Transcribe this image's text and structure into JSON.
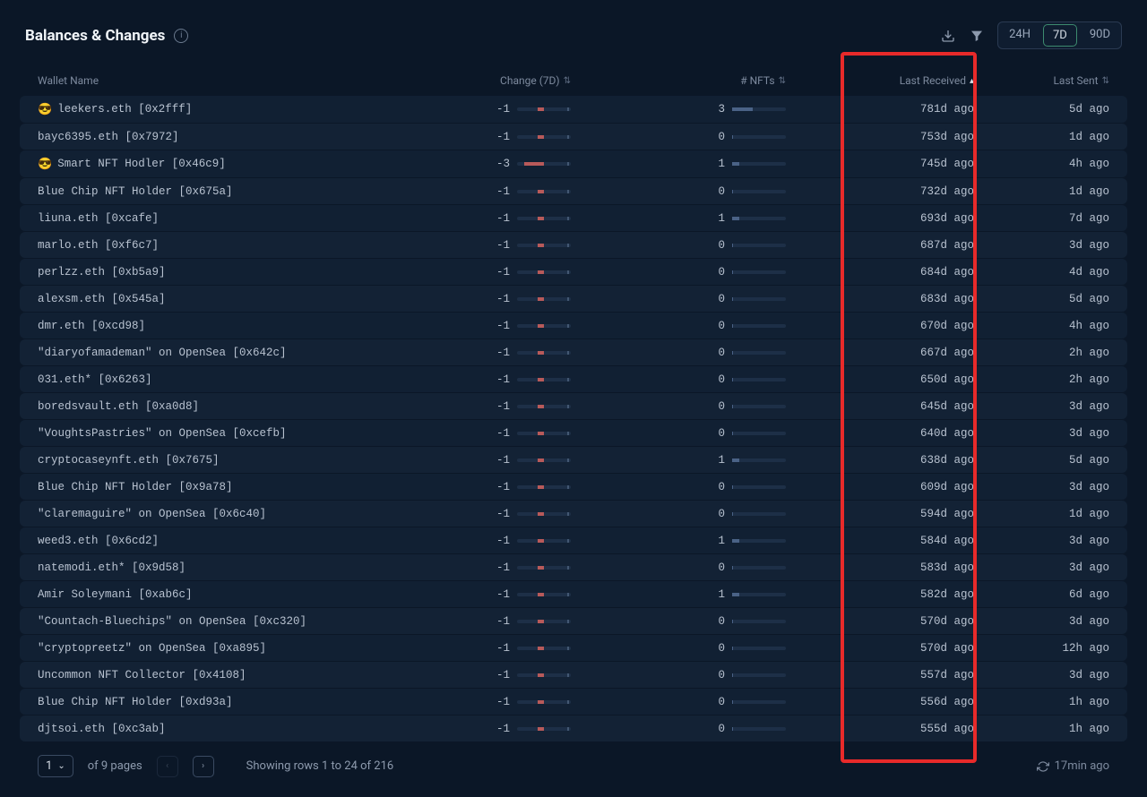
{
  "header": {
    "title": "Balances & Changes",
    "timeRanges": [
      "24H",
      "7D",
      "90D"
    ],
    "activeRange": "7D"
  },
  "columns": {
    "walletName": "Wallet Name",
    "change": "Change (7D)",
    "nfts": "# NFTs",
    "lastReceived": "Last Received",
    "lastSent": "Last Sent"
  },
  "rows": [
    {
      "emoji": "😎",
      "name": "leekers.eth [0x2fff]",
      "change": -1,
      "nfts": 3,
      "received": "781d ago",
      "sent": "5d ago"
    },
    {
      "emoji": "",
      "name": "bayc6395.eth [0x7972]",
      "change": -1,
      "nfts": 0,
      "received": "753d ago",
      "sent": "1d ago"
    },
    {
      "emoji": "😎",
      "name": "Smart NFT Hodler [0x46c9]",
      "change": -3,
      "nfts": 1,
      "received": "745d ago",
      "sent": "4h ago"
    },
    {
      "emoji": "",
      "name": "Blue Chip NFT Holder [0x675a]",
      "change": -1,
      "nfts": 0,
      "received": "732d ago",
      "sent": "1d ago"
    },
    {
      "emoji": "",
      "name": "liuna.eth [0xcafe]",
      "change": -1,
      "nfts": 1,
      "received": "693d ago",
      "sent": "7d ago"
    },
    {
      "emoji": "",
      "name": "marlo.eth [0xf6c7]",
      "change": -1,
      "nfts": 0,
      "received": "687d ago",
      "sent": "3d ago"
    },
    {
      "emoji": "",
      "name": "perlzz.eth [0xb5a9]",
      "change": -1,
      "nfts": 0,
      "received": "684d ago",
      "sent": "4d ago"
    },
    {
      "emoji": "",
      "name": "alexsm.eth [0x545a]",
      "change": -1,
      "nfts": 0,
      "received": "683d ago",
      "sent": "5d ago"
    },
    {
      "emoji": "",
      "name": "dmr.eth [0xcd98]",
      "change": -1,
      "nfts": 0,
      "received": "670d ago",
      "sent": "4h ago"
    },
    {
      "emoji": "",
      "name": "\"diaryofamademan\" on OpenSea [0x642c]",
      "change": -1,
      "nfts": 0,
      "received": "667d ago",
      "sent": "2h ago"
    },
    {
      "emoji": "",
      "name": "031.eth* [0x6263]",
      "change": -1,
      "nfts": 0,
      "received": "650d ago",
      "sent": "2h ago"
    },
    {
      "emoji": "",
      "name": "boredsvault.eth [0xa0d8]",
      "change": -1,
      "nfts": 0,
      "received": "645d ago",
      "sent": "3d ago"
    },
    {
      "emoji": "",
      "name": "\"VoughtsPastries\" on OpenSea [0xcefb]",
      "change": -1,
      "nfts": 0,
      "received": "640d ago",
      "sent": "3d ago"
    },
    {
      "emoji": "",
      "name": "cryptocaseynft.eth [0x7675]",
      "change": -1,
      "nfts": 1,
      "received": "638d ago",
      "sent": "5d ago"
    },
    {
      "emoji": "",
      "name": "Blue Chip NFT Holder [0x9a78]",
      "change": -1,
      "nfts": 0,
      "received": "609d ago",
      "sent": "3d ago"
    },
    {
      "emoji": "",
      "name": "\"claremaguire\" on OpenSea [0x6c40]",
      "change": -1,
      "nfts": 0,
      "received": "594d ago",
      "sent": "1d ago"
    },
    {
      "emoji": "",
      "name": "weed3.eth [0x6cd2]",
      "change": -1,
      "nfts": 1,
      "received": "584d ago",
      "sent": "3d ago"
    },
    {
      "emoji": "",
      "name": "natemodi.eth* [0x9d58]",
      "change": -1,
      "nfts": 0,
      "received": "583d ago",
      "sent": "3d ago"
    },
    {
      "emoji": "",
      "name": "Amir Soleymani [0xab6c]",
      "change": -1,
      "nfts": 1,
      "received": "582d ago",
      "sent": "6d ago"
    },
    {
      "emoji": "",
      "name": "\"Countach-Bluechips\" on OpenSea [0xc320]",
      "change": -1,
      "nfts": 0,
      "received": "570d ago",
      "sent": "3d ago"
    },
    {
      "emoji": "",
      "name": "\"cryptopreetz\" on OpenSea [0xa895]",
      "change": -1,
      "nfts": 0,
      "received": "570d ago",
      "sent": "12h ago"
    },
    {
      "emoji": "",
      "name": "Uncommon NFT Collector [0x4108]",
      "change": -1,
      "nfts": 0,
      "received": "557d ago",
      "sent": "3d ago"
    },
    {
      "emoji": "",
      "name": "Blue Chip NFT Holder [0xd93a]",
      "change": -1,
      "nfts": 0,
      "received": "556d ago",
      "sent": "1h ago"
    },
    {
      "emoji": "",
      "name": "djtsoi.eth [0xc3ab]",
      "change": -1,
      "nfts": 0,
      "received": "555d ago",
      "sent": "1h ago"
    }
  ],
  "footer": {
    "currentPage": "1",
    "pagesLabel": "of 9 pages",
    "rowsSummary": "Showing rows 1 to 24 of 216",
    "updated": "17min ago"
  }
}
